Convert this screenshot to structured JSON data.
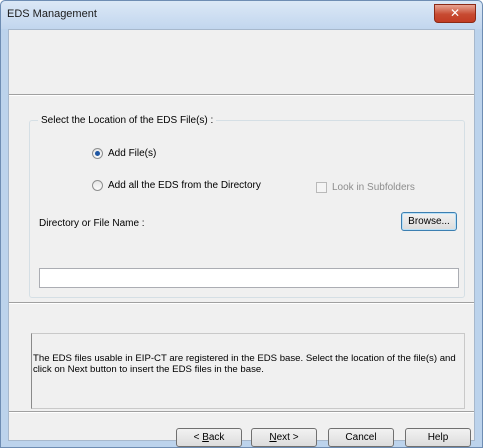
{
  "window": {
    "title": "EDS Management",
    "close_glyph": "✕"
  },
  "location_group": {
    "legend": "Select the Location of the EDS File(s) :",
    "option_add_files": "Add File(s)",
    "option_add_directory": "Add all the EDS from the Directory",
    "selected_option": "Add File(s)",
    "look_in_subfolders": "Look in Subfolders",
    "look_in_subfolders_checked": false,
    "look_in_subfolders_enabled": false,
    "directory_label": "Directory or File Name :",
    "browse_label": "Browse...",
    "path_value": ""
  },
  "info": {
    "text": "The EDS files usable in EIP-CT are registered in the EDS base. Select the location of the file(s) and click on Next button to insert the EDS files in the base."
  },
  "footer": {
    "back_prefix": "< ",
    "back_key": "B",
    "back_rest": "ack",
    "next_key": "N",
    "next_rest": "ext >",
    "cancel_label": "Cancel",
    "help_label": "Help"
  },
  "colors": {
    "title_bar": "#c2d6ee",
    "close_button": "#c74a31",
    "client_bg": "#f0f0f0",
    "radio_dot": "#1f57a4"
  },
  "icons": {
    "close": "close-icon"
  }
}
